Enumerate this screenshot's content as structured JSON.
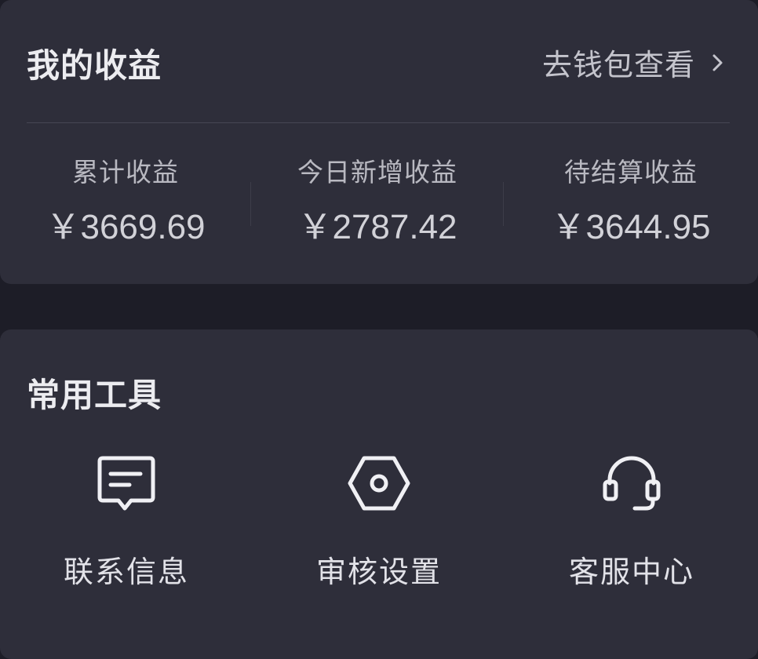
{
  "earnings": {
    "title": "我的收益",
    "wallet_link": "去钱包查看",
    "stats": [
      {
        "label": "累计收益",
        "value": "￥3669.69"
      },
      {
        "label": "今日新增收益",
        "value": "￥2787.42"
      },
      {
        "label": "待结算收益",
        "value": "￥3644.95"
      }
    ]
  },
  "tools": {
    "title": "常用工具",
    "items": [
      {
        "label": "联系信息",
        "icon": "message-icon"
      },
      {
        "label": "审核设置",
        "icon": "settings-hex-icon"
      },
      {
        "label": "客服中心",
        "icon": "headset-icon"
      }
    ]
  }
}
